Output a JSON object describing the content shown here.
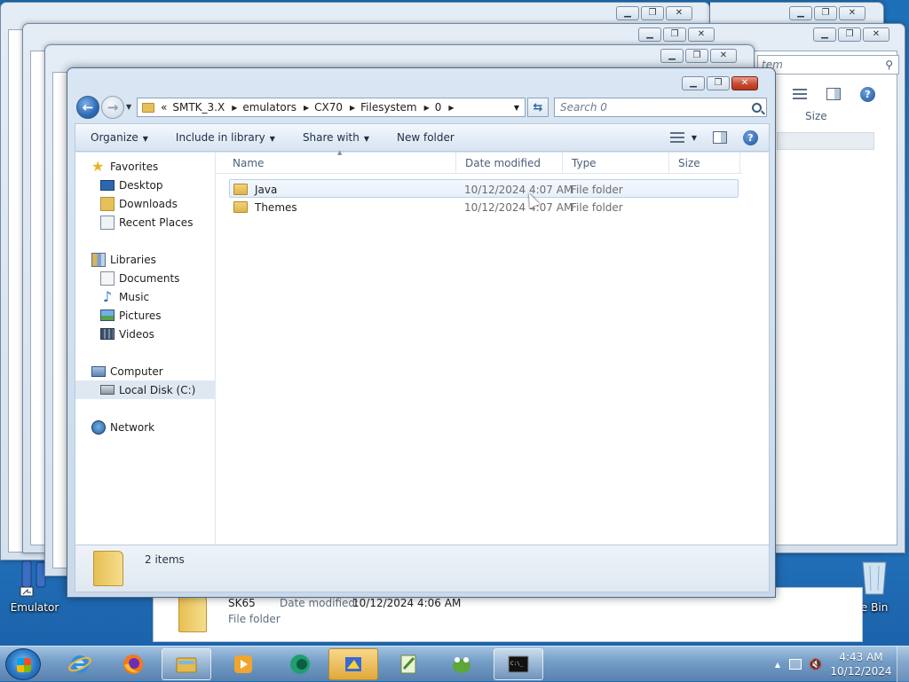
{
  "desktop": {
    "icons": [
      {
        "label": "Emulator"
      },
      {
        "label": "cle Bin"
      }
    ]
  },
  "background_windows": {
    "search_fragment": "tem",
    "size_header": "Size"
  },
  "bottom_window": {
    "item_name": "SK65",
    "date_label": "Date modified:",
    "date_value": "10/12/2024 4:06 AM",
    "item_type": "File folder"
  },
  "explorer": {
    "breadcrumb_overflow": "«",
    "breadcrumb": [
      "SMTK_3.X",
      "emulators",
      "CX70",
      "Filesystem",
      "0"
    ],
    "search_placeholder": "Search 0",
    "commands": {
      "organize": "Organize",
      "include_in_library": "Include in library",
      "share_with": "Share with",
      "new_folder": "New folder"
    },
    "nav": {
      "favorites": "Favorites",
      "desktop": "Desktop",
      "downloads": "Downloads",
      "recent_places": "Recent Places",
      "libraries": "Libraries",
      "documents": "Documents",
      "music": "Music",
      "pictures": "Pictures",
      "videos": "Videos",
      "computer": "Computer",
      "local_disk": "Local Disk (C:)",
      "network": "Network"
    },
    "columns": {
      "name": "Name",
      "date_modified": "Date modified",
      "type": "Type",
      "size": "Size"
    },
    "files": [
      {
        "name": "Java",
        "date": "10/12/2024 4:07 AM",
        "type": "File folder",
        "size": ""
      },
      {
        "name": "Themes",
        "date": "10/12/2024 4:07 AM",
        "type": "File folder",
        "size": ""
      }
    ],
    "status": "2 items"
  },
  "taskbar": {
    "time": "4:43 AM",
    "date": "10/12/2024",
    "pinned": [
      "internet-explorer",
      "firefox",
      "windows-explorer",
      "media-player",
      "app-green-globe",
      "notepad-plus",
      "app-frog",
      "command-prompt"
    ]
  },
  "colors": {
    "accent": "#2a77c3",
    "close_button": "#c84b32",
    "selection": "#e7f0fb"
  }
}
